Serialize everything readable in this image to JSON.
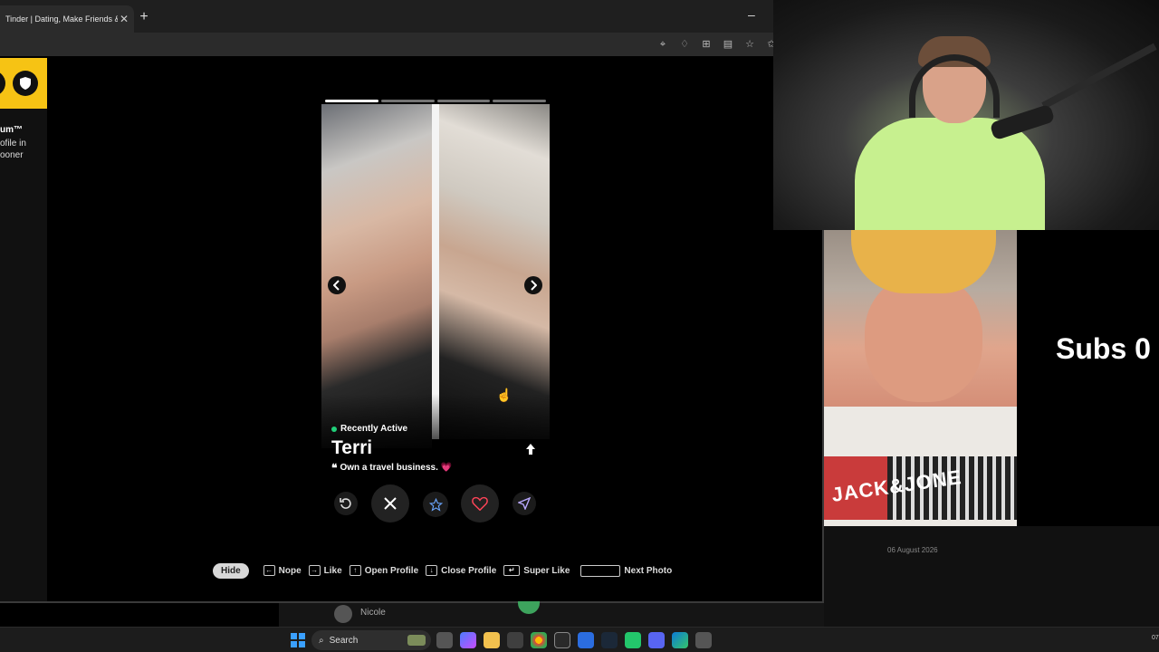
{
  "browser": {
    "tab_title": "Tinder | Dating, Make Friends & M",
    "tab_close": "✕",
    "new_tab": "+",
    "minimize": "–"
  },
  "promo": {
    "title": "um™",
    "line1": "ofile in",
    "line2": "ooner"
  },
  "profile": {
    "status": "Recently Active",
    "name": "Terri",
    "bio": "Own a travel business.",
    "bio_emoji": "💗",
    "photo_count": 4,
    "active_photo": 1
  },
  "actions": {
    "rewind": "rewind",
    "nope": "nope",
    "super_like": "super-like",
    "like": "like",
    "boost": "boost"
  },
  "shortcuts": {
    "hide": "Hide",
    "items": [
      {
        "key": "←",
        "label": "Nope"
      },
      {
        "key": "→",
        "label": "Like"
      },
      {
        "key": "↑",
        "label": "Open Profile"
      },
      {
        "key": "↓",
        "label": "Close Profile"
      },
      {
        "key": "↵",
        "label": "Super Like"
      },
      {
        "key": "",
        "label": "Next Photo"
      }
    ]
  },
  "overlay": {
    "subs": "Subs 0",
    "date": "06 August 2026",
    "shirt_print": "JACK&JONE"
  },
  "chat": {
    "name": "Nicole"
  },
  "taskbar": {
    "search": "Search",
    "clock": "07"
  },
  "colors": {
    "accent_yellow": "#f6c314",
    "active_green": "#21d07a",
    "like_red": "#ff4458"
  }
}
